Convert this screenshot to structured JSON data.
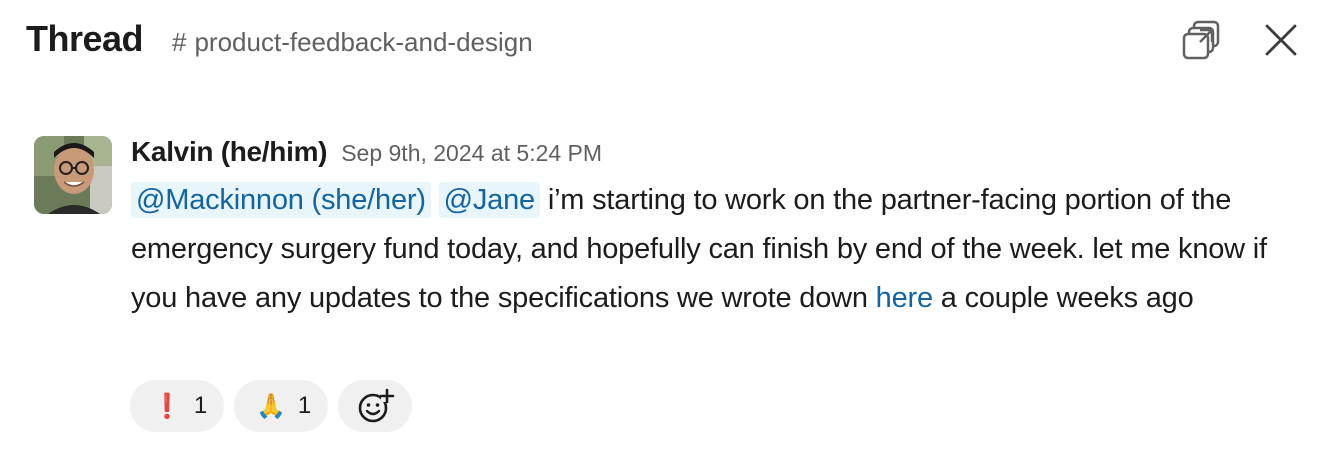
{
  "header": {
    "title": "Thread",
    "channel_prefix": "#",
    "channel_name": "product-feedback-and-design",
    "popout_icon": "popout-icon",
    "close_icon": "close-icon"
  },
  "message": {
    "author": "Kalvin (he/him)",
    "timestamp": "Sep 9th, 2024 at 5:24 PM",
    "mention_1": "@Mackinnon (she/her)",
    "mention_2": "@Jane",
    "text_1": " i’m starting to work on the partner-facing portion of the emergency surgery fund today, and hopefully can finish by end of the week. let me know if you have any updates to the specifications we wrote down ",
    "link_text": "here",
    "text_2": " a couple weeks ago"
  },
  "reactions": [
    {
      "emoji": "❗",
      "count": "1",
      "icon": "exclamation-emoji-icon"
    },
    {
      "emoji": "🙏",
      "count": "1",
      "icon": "folded-hands-emoji-icon"
    }
  ],
  "add_reaction_icon": "add-reaction-icon",
  "colors": {
    "mention_bg": "#e8f5fa",
    "link": "#1264a3",
    "muted": "#616061",
    "reaction_bg": "#f0f0f0"
  }
}
